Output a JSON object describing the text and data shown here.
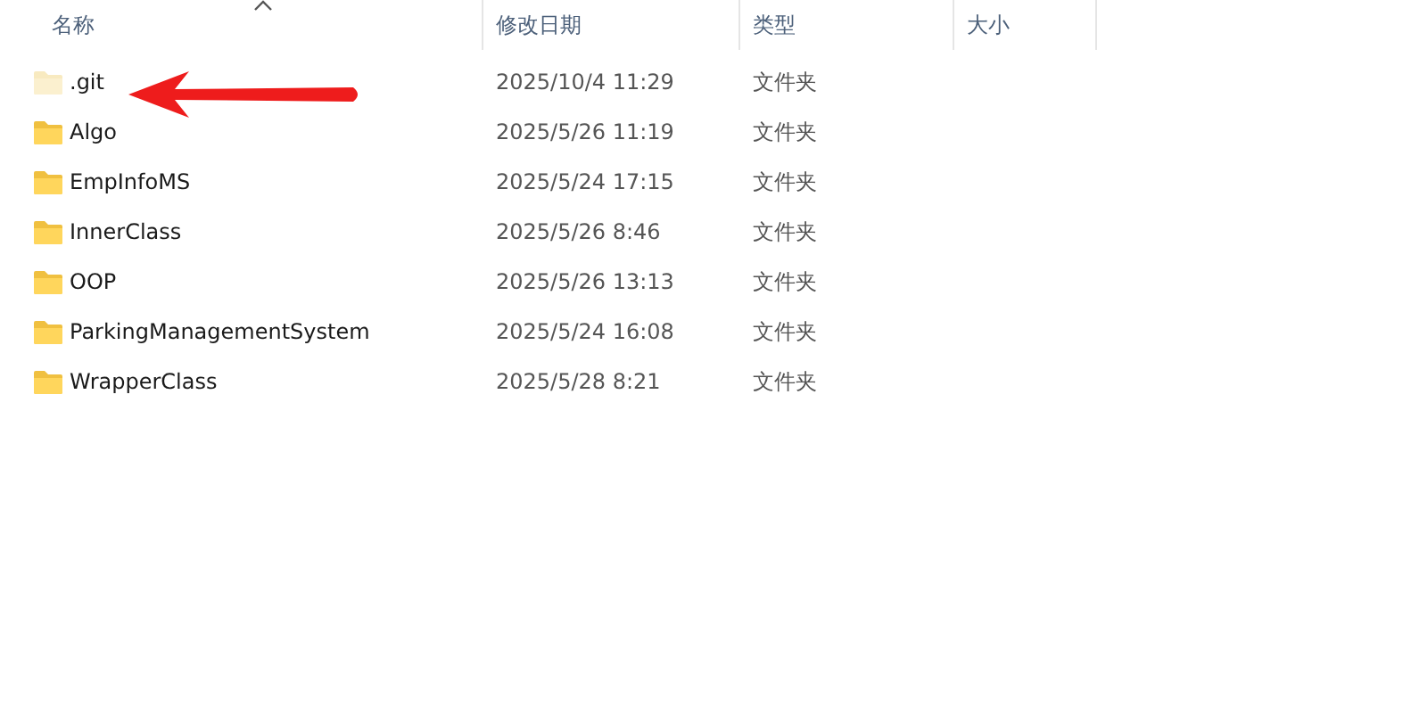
{
  "columns": [
    {
      "label": "名称",
      "sorted": true
    },
    {
      "label": "修改日期",
      "sorted": false
    },
    {
      "label": "类型",
      "sorted": false
    },
    {
      "label": "大小",
      "sorted": false
    }
  ],
  "rows": [
    {
      "name": ".git",
      "modified": "2025/10/4 11:29",
      "type": "文件夹",
      "hidden": true,
      "arrow_marked": true
    },
    {
      "name": "Algo",
      "modified": "2025/5/26 11:19",
      "type": "文件夹",
      "hidden": false
    },
    {
      "name": "EmpInfoMS",
      "modified": "2025/5/24 17:15",
      "type": "文件夹",
      "hidden": false
    },
    {
      "name": "InnerClass",
      "modified": "2025/5/26 8:46",
      "type": "文件夹",
      "hidden": false
    },
    {
      "name": "OOP",
      "modified": "2025/5/26 13:13",
      "type": "文件夹",
      "hidden": false
    },
    {
      "name": "ParkingManagementSystem",
      "modified": "2025/5/24 16:08",
      "type": "文件夹",
      "hidden": false
    },
    {
      "name": "WrapperClass",
      "modified": "2025/5/28 8:21",
      "type": "文件夹",
      "hidden": false
    }
  ]
}
